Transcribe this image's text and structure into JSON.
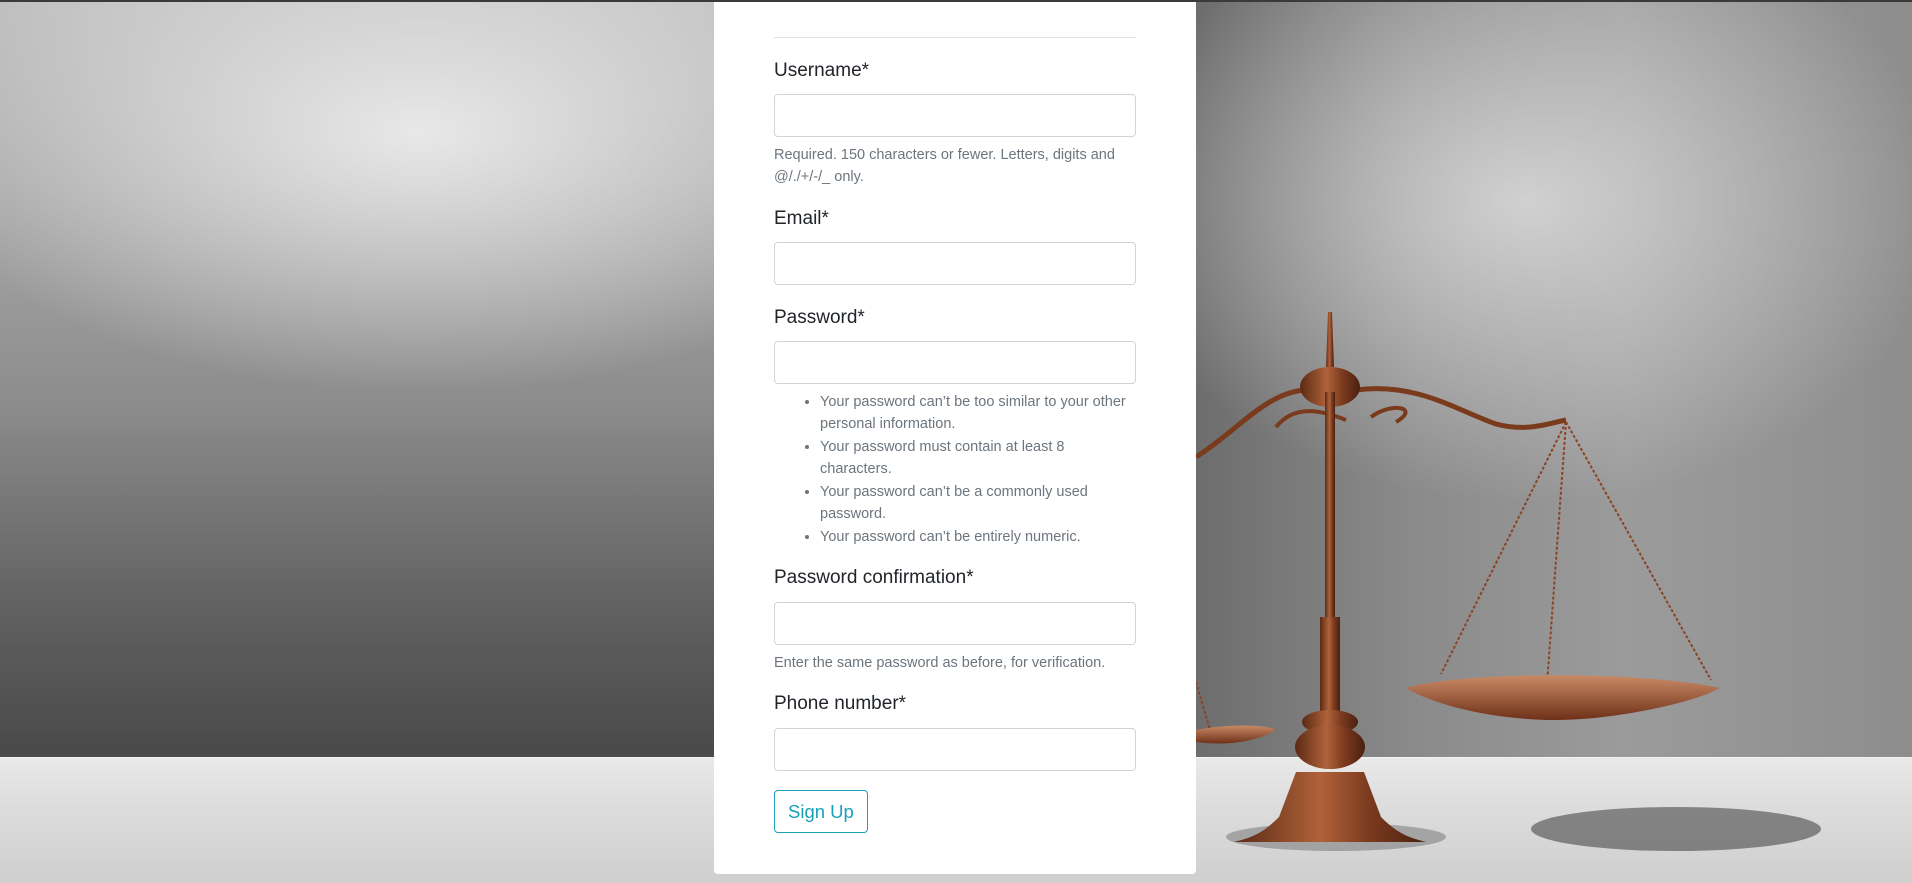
{
  "form": {
    "username": {
      "label": "Username*",
      "value": "",
      "help": "Required. 150 characters or fewer. Letters, digits and @/./+/-/_ only."
    },
    "email": {
      "label": "Email*",
      "value": ""
    },
    "password": {
      "label": "Password*",
      "value": "",
      "help_items": [
        "Your password can’t be too similar to your other personal information.",
        "Your password must contain at least 8 characters.",
        "Your password can’t be a commonly used password.",
        "Your password can’t be entirely numeric."
      ]
    },
    "password_confirmation": {
      "label": "Password confirmation*",
      "value": "",
      "help": "Enter the same password as before, for verification."
    },
    "phone": {
      "label": "Phone number*",
      "value": ""
    },
    "submit_label": "Sign Up"
  },
  "colors": {
    "accent": "#17a2b8",
    "help_text": "#6c757d",
    "label_text": "#212529",
    "input_border": "#ced4da"
  },
  "background": {
    "image": "scales-of-justice"
  }
}
